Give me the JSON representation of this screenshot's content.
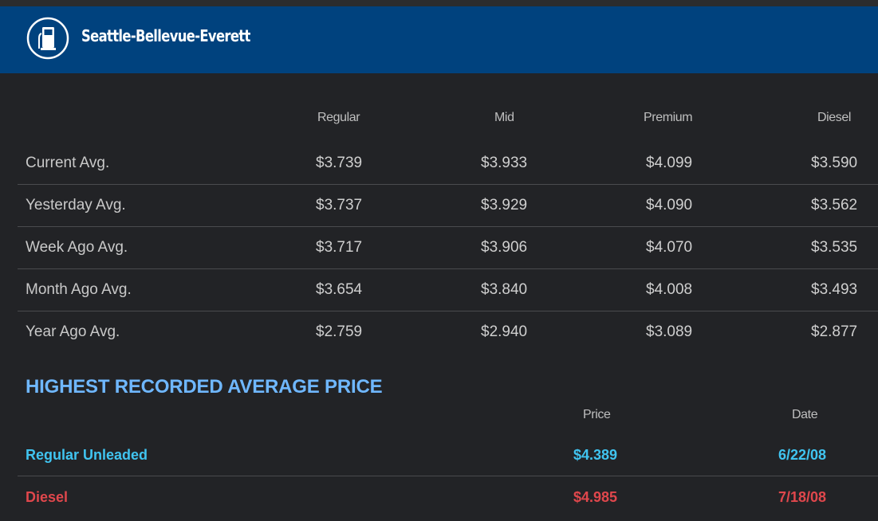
{
  "header": {
    "title": "Seattle-Bellevue-Everett",
    "icon": "gas-pump-icon"
  },
  "colors": {
    "header_bg": "#00427e",
    "section_title": "#6fb7ff",
    "regular": "#40c4f0",
    "diesel": "#e0474c"
  },
  "table": {
    "columns": [
      "Regular",
      "Mid",
      "Premium",
      "Diesel"
    ],
    "rows": [
      {
        "label": "Current Avg.",
        "values": [
          "$3.739",
          "$3.933",
          "$4.099",
          "$3.590"
        ]
      },
      {
        "label": "Yesterday Avg.",
        "values": [
          "$3.737",
          "$3.929",
          "$4.090",
          "$3.562"
        ]
      },
      {
        "label": "Week Ago Avg.",
        "values": [
          "$3.717",
          "$3.906",
          "$4.070",
          "$3.535"
        ]
      },
      {
        "label": "Month Ago Avg.",
        "values": [
          "$3.654",
          "$3.840",
          "$4.008",
          "$3.493"
        ]
      },
      {
        "label": "Year Ago Avg.",
        "values": [
          "$2.759",
          "$2.940",
          "$3.089",
          "$2.877"
        ]
      }
    ]
  },
  "highest": {
    "title": "HIGHEST RECORDED AVERAGE PRICE",
    "columns": {
      "price": "Price",
      "date": "Date"
    },
    "rows": [
      {
        "label": "Regular Unleaded",
        "price": "$4.389",
        "date": "6/22/08"
      },
      {
        "label": "Diesel",
        "price": "$4.985",
        "date": "7/18/08"
      }
    ]
  }
}
